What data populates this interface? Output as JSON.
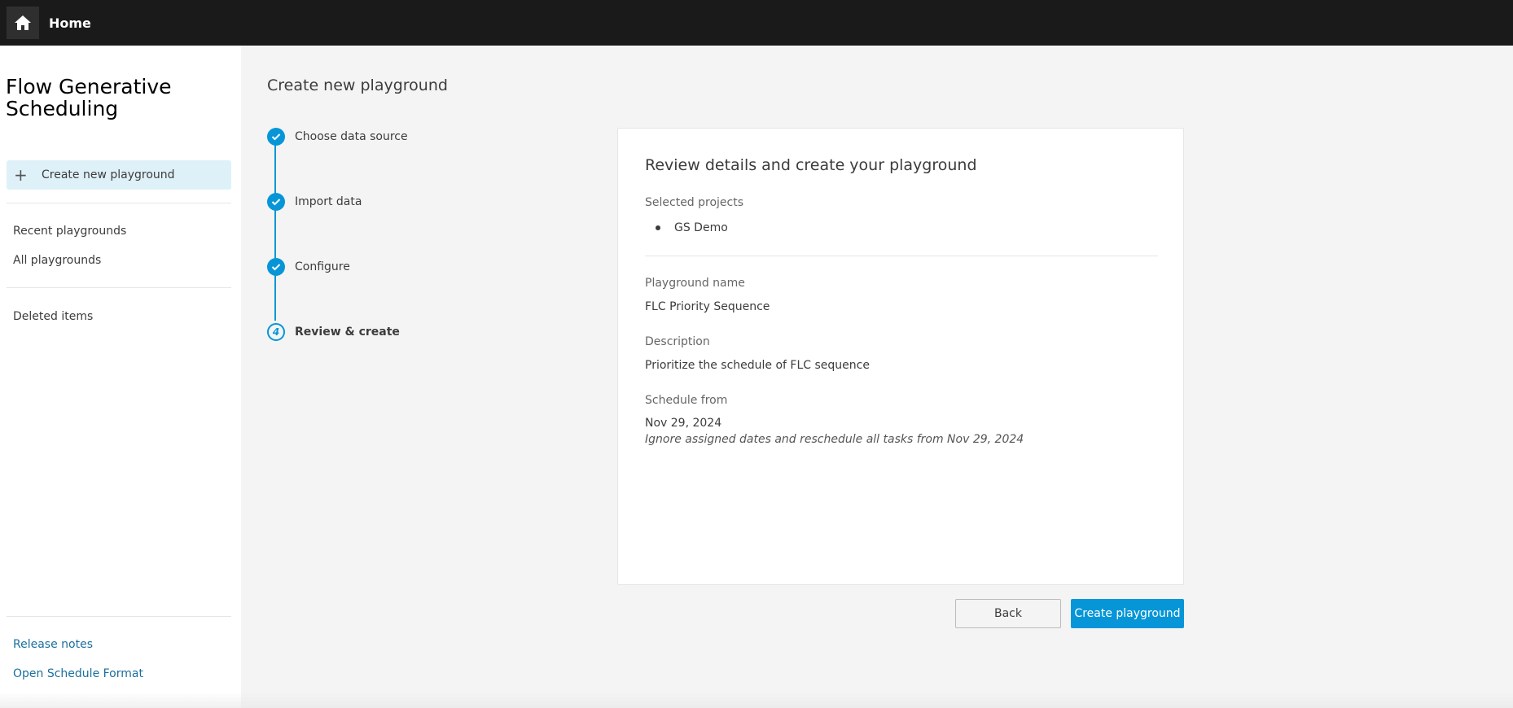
{
  "topbar": {
    "home_icon": "home-icon",
    "title": "Home"
  },
  "sidebar": {
    "app_title": "Flow Generative Scheduling",
    "create_item": {
      "icon": "plus-icon",
      "label": "Create new playground"
    },
    "nav_items": [
      {
        "label": "Recent playgrounds"
      },
      {
        "label": "All playgrounds"
      },
      {
        "label": "Deleted items"
      }
    ],
    "links": [
      {
        "label": "Release notes"
      },
      {
        "label": "Open Schedule Format"
      }
    ]
  },
  "main": {
    "page_title": "Create new playground",
    "steps": [
      {
        "label": "Choose data source",
        "status": "complete",
        "icon": "check-icon"
      },
      {
        "label": "Import data",
        "status": "complete",
        "icon": "check-icon"
      },
      {
        "label": "Configure",
        "status": "complete",
        "icon": "check-icon"
      },
      {
        "label": "Review & create",
        "status": "current",
        "number": "4"
      }
    ],
    "card": {
      "title": "Review details and create your playground",
      "selected_projects_label": "Selected projects",
      "selected_projects": [
        "GS Demo"
      ],
      "playground_name_label": "Playground name",
      "playground_name": "FLC Priority Sequence",
      "description_label": "Description",
      "description": "Prioritize the schedule of FLC sequence",
      "schedule_from_label": "Schedule from",
      "schedule_from": "Nov 29, 2024",
      "schedule_note": "Ignore assigned dates and reschedule all tasks from Nov 29, 2024"
    },
    "buttons": {
      "back": "Back",
      "create": "Create playground"
    }
  },
  "colors": {
    "accent": "#0696d7",
    "topbar": "#1a1a1a",
    "selected_nav_bg": "#dff1f8",
    "link": "#1a6f9e"
  }
}
